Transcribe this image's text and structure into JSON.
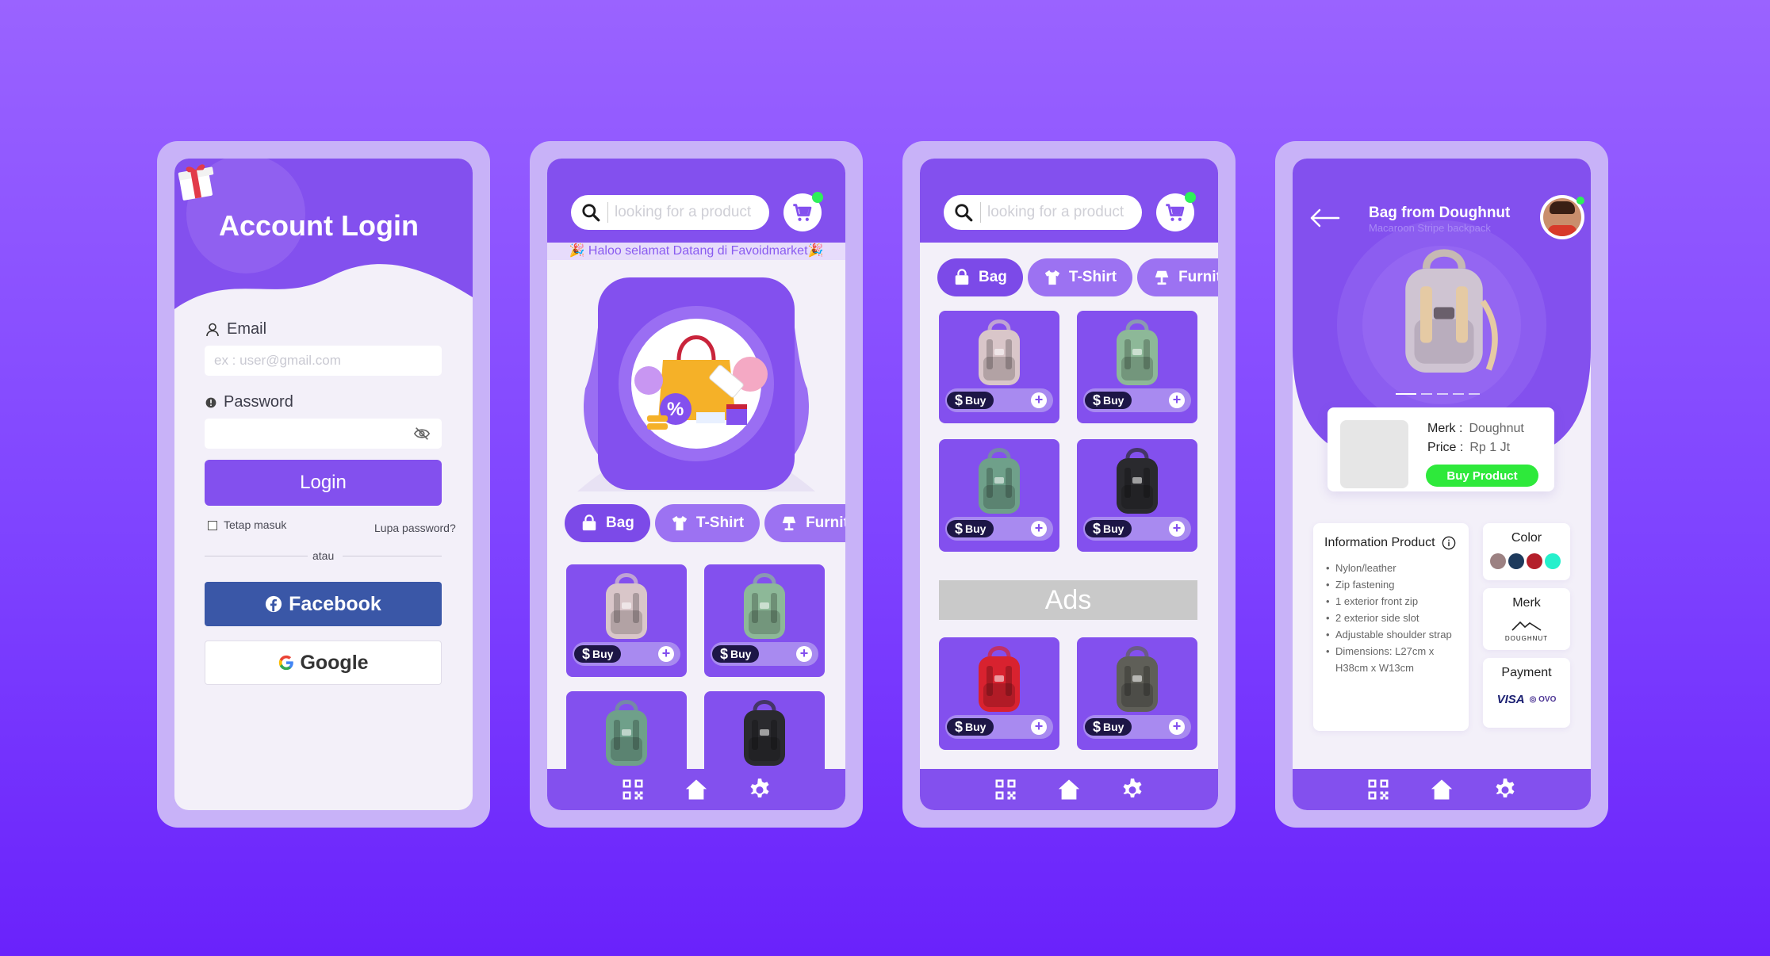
{
  "login": {
    "title": "Account Login",
    "email_label": "Email",
    "email_placeholder": "ex : user@gmail.com",
    "password_label": "Password",
    "login_button": "Login",
    "remember_label": "Tetap masuk",
    "forgot_label": "Lupa password?",
    "or_label": "atau",
    "facebook_label": "Facebook",
    "google_label": "Google"
  },
  "search_placeholder": "looking for a product",
  "welcome_text": "🎉 Haloo selamat Datang di Favoidmarket🎉",
  "categories": [
    "Bag",
    "T-Shirt",
    "Furniture"
  ],
  "buy_label": "Buy",
  "ads_label": "Ads",
  "product": {
    "title": "Bag from Doughnut",
    "subtitle": "Macaroon Stripe backpack",
    "merk_label": "Merk :",
    "merk_value": "Doughnut",
    "price_label": "Price :",
    "price_value": "Rp 1 Jt",
    "buy_button": "Buy Product",
    "info_title": "Information Product",
    "specs": [
      "Nylon/leather",
      "Zip fastening",
      "1 exterior front zip",
      "2 exterior side slot",
      "Adjustable shoulder strap",
      "Dimensions: L27cm x H38cm x W13cm"
    ],
    "color_title": "Color",
    "colors": [
      "#9c8182",
      "#1d3a5c",
      "#b41f2a",
      "#25f0cc"
    ],
    "merk_title": "Merk",
    "brand_logo_text": "DOUGHNUT",
    "payment_title": "Payment",
    "payment_visa": "VISA",
    "payment_ovo": "OVO"
  },
  "colors": {
    "primary": "#8350ee",
    "background": "#7f44ff",
    "accent_green": "#2ee93b",
    "facebook": "#3a57a7"
  }
}
